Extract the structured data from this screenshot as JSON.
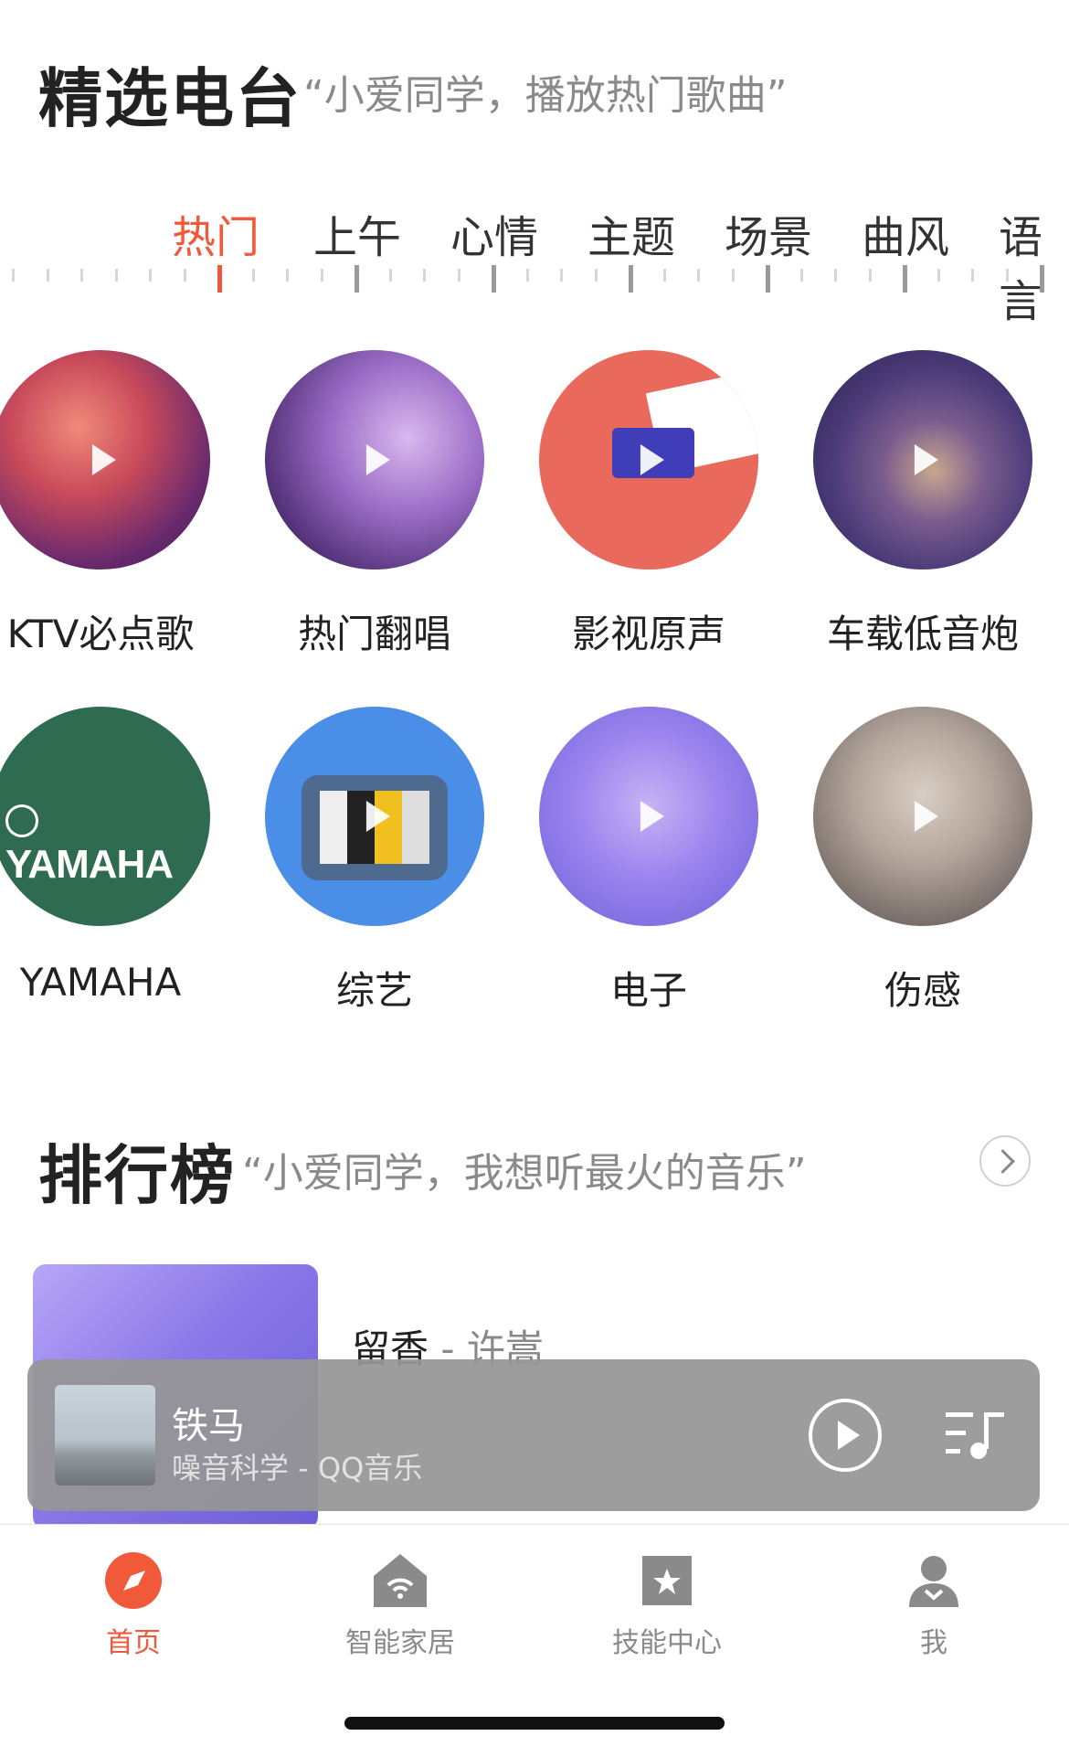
{
  "featured": {
    "title": "精选电台",
    "subtitle": "“小爱同学，播放热门歌曲”",
    "tabs": [
      "热门",
      "上午",
      "心情",
      "主题",
      "场景",
      "曲风",
      "语言"
    ],
    "active_tab": "热门",
    "stations": [
      {
        "label": "KTV必点歌"
      },
      {
        "label": "热门翻唱"
      },
      {
        "label": "影视原声"
      },
      {
        "label": "车载低音炮"
      },
      {
        "label": "YAMAHA",
        "logo_text": "YAMAHA"
      },
      {
        "label": "综艺"
      },
      {
        "label": "电子"
      },
      {
        "label": "伤感"
      }
    ]
  },
  "charts": {
    "title": "排行榜",
    "subtitle": "“小爱同学，我想听最火的音乐”",
    "song": "留香",
    "separator": "-",
    "artist": "许嵩"
  },
  "player": {
    "title": "铁马",
    "subtitle": "噪音科学 - QQ音乐"
  },
  "nav": {
    "items": [
      {
        "label": "首页",
        "icon": "compass-icon",
        "active": true
      },
      {
        "label": "智能家居",
        "icon": "smart-home-icon",
        "active": false
      },
      {
        "label": "技能中心",
        "icon": "star-badge-icon",
        "active": false
      },
      {
        "label": "我",
        "icon": "profile-icon",
        "active": false
      }
    ]
  },
  "colors": {
    "accent": "#f0593a",
    "yamaha_green": "#2f6b50",
    "player_bg": "#969696"
  }
}
